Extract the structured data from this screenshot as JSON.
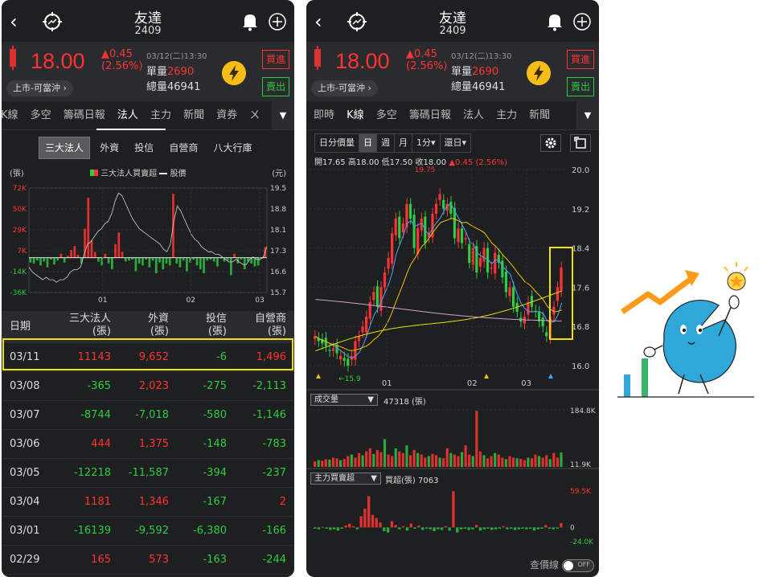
{
  "stock": {
    "name": "友達",
    "code": "2409",
    "price": "18.00",
    "change": "▲0.45",
    "change_pct": "(2.56%)",
    "datetime": "03/12(二)13:30",
    "unit_vol_label": "單量",
    "unit_vol": "2690",
    "total_vol_label": "總量",
    "total_vol": "46941",
    "market": "上市-可當沖",
    "buy": "買進",
    "sell": "賣出"
  },
  "left": {
    "tabs": [
      "K線",
      "多空",
      "籌碼日報",
      "法人",
      "主力",
      "新聞",
      "資券",
      "ㄨ"
    ],
    "active_tab": "法人",
    "subtabs": [
      "三大法人",
      "外資",
      "投信",
      "自營商",
      "八大行庫"
    ],
    "chart_labels": {
      "left_unit": "(張)",
      "right_unit": "(元)",
      "legend_bar": "三大法人買賣超",
      "legend_line": "股價"
    },
    "table_headers": {
      "date": "日期",
      "three": "三大法人",
      "three_unit": "(張)",
      "foreign": "外資",
      "foreign_unit": "(張)",
      "trust": "投信",
      "trust_unit": "(張)",
      "dealer": "自營商",
      "dealer_unit": "(張)"
    },
    "rows": [
      {
        "date": "03/11",
        "three": "11143",
        "foreign": "9,652",
        "trust": "-6",
        "dealer": "1,496"
      },
      {
        "date": "03/08",
        "three": "-365",
        "foreign": "2,023",
        "trust": "-275",
        "dealer": "-2,113"
      },
      {
        "date": "03/07",
        "three": "-8744",
        "foreign": "-7,018",
        "trust": "-580",
        "dealer": "-1,146"
      },
      {
        "date": "03/06",
        "three": "444",
        "foreign": "1,375",
        "trust": "-148",
        "dealer": "-783"
      },
      {
        "date": "03/05",
        "three": "-12218",
        "foreign": "-11,587",
        "trust": "-394",
        "dealer": "-237"
      },
      {
        "date": "03/04",
        "three": "1181",
        "foreign": "1,346",
        "trust": "-167",
        "dealer": "2"
      },
      {
        "date": "03/01",
        "three": "-16139",
        "foreign": "-9,592",
        "trust": "-6,380",
        "dealer": "-166"
      },
      {
        "date": "02/29",
        "three": "165",
        "foreign": "573",
        "trust": "-163",
        "dealer": "-244"
      }
    ]
  },
  "right": {
    "tabs": [
      "即時",
      "K線",
      "多空",
      "籌碼日報",
      "法人",
      "主力",
      "新聞"
    ],
    "active_tab": "K線",
    "toolbar": [
      "日分價量",
      "日",
      "週",
      "月",
      "1分▾",
      "還日▾"
    ],
    "active_tool": "日",
    "ohlc": {
      "o": "開17.65",
      "h": "高18.00",
      "l": "低17.50",
      "c": "收18.00",
      "chg": "▲0.45 (2.56%)"
    },
    "vol_select": "成交量",
    "vol_value": "47318 (張)",
    "main_select": "主力買賣超",
    "main_value": "買超(張) 7063",
    "check_line": "查價線",
    "toggle": "OFF"
  },
  "chart_data": [
    {
      "type": "bar",
      "title": "三大法人買賣超",
      "ylabel": "(張)",
      "ylabel_right": "(元)",
      "y_ticks": [
        "72K",
        "50K",
        "29K",
        "7K",
        "-14K",
        "-36K"
      ],
      "y_right_ticks": [
        "19.5",
        "18.8",
        "18.1",
        "17.3",
        "16.6",
        "15.7"
      ],
      "x_ticks": [
        "01",
        "02",
        "03"
      ],
      "series": [
        {
          "name": "三大法人買賣超",
          "values": [
            -5,
            -6,
            -3,
            -8,
            -4,
            -10,
            -2,
            -7,
            -3,
            4,
            -5,
            2,
            8,
            12,
            3,
            -6,
            30,
            62,
            18,
            6,
            -4,
            -8,
            4,
            -6,
            -12,
            14,
            26,
            6,
            -4,
            -3,
            -2,
            -14,
            -6,
            -8,
            -2,
            -10,
            -3,
            -16,
            -5,
            -12,
            -6,
            -8,
            66,
            -6,
            -10,
            -3,
            -14,
            -5,
            -2,
            -8,
            -12,
            -16,
            -3,
            -2,
            -4,
            -9,
            -1,
            -4,
            -3,
            -18,
            4,
            -6,
            -2,
            -12,
            -4,
            -6,
            -9,
            -8,
            -1,
            11
          ]
        },
        {
          "name": "股價",
          "values": [
            16.7,
            16.5,
            16.4,
            16.3,
            16.2,
            16.3,
            16.2,
            16.2,
            16.1,
            16.2,
            16.2,
            16.3,
            16.5,
            16.6,
            16.6,
            16.7,
            17.2,
            17.6,
            17.7,
            17.9,
            18.1,
            18.2,
            18.4,
            18.5,
            18.8,
            19.3,
            19.6,
            19.5,
            19.2,
            18.9,
            18.6,
            18.4,
            18.2,
            18.1,
            18.0,
            17.9,
            17.8,
            17.7,
            17.6,
            17.4,
            17.3,
            17.6,
            18.5,
            19.1,
            18.9,
            18.6,
            18.3,
            18.0,
            17.8,
            17.7,
            17.5,
            17.4,
            17.3,
            17.3,
            17.2,
            17.2,
            17.1,
            17.0,
            16.9,
            16.9,
            17.0,
            16.9,
            16.8,
            16.8,
            17.0,
            17.1,
            17.0,
            17.0,
            17.1,
            17.5
          ]
        }
      ]
    },
    {
      "type": "line",
      "title": "K線",
      "y_ticks": [
        "20.0",
        "19.2",
        "18.4",
        "17.6",
        "16.8",
        "16.0"
      ],
      "ylim": [
        16.0,
        20.0
      ],
      "x_ticks": [
        "01",
        "02",
        "03"
      ],
      "annotations": [
        "19.75",
        "15.9"
      ],
      "close": [
        16.6,
        16.5,
        16.45,
        16.4,
        16.3,
        16.35,
        16.25,
        16.2,
        16.1,
        16.0,
        16.2,
        16.5,
        16.6,
        16.8,
        17.0,
        17.3,
        17.5,
        17.2,
        17.6,
        17.9,
        18.2,
        18.7,
        19.0,
        18.6,
        18.9,
        19.3,
        19.0,
        18.4,
        18.8,
        19.0,
        18.5,
        18.7,
        19.1,
        19.3,
        19.5,
        19.2,
        19.3,
        19.1,
        18.6,
        18.8,
        18.5,
        18.6,
        18.1,
        18.4,
        17.9,
        18.2,
        18.4,
        17.9,
        18.0,
        18.3,
        18.1,
        17.8,
        17.5,
        17.6,
        17.2,
        17.1,
        16.9,
        17.0,
        17.3,
        17.2,
        17.1,
        16.9,
        16.8,
        16.6,
        17.0,
        17.2,
        17.6,
        18.0
      ]
    },
    {
      "type": "bar",
      "title": "成交量",
      "y_ticks": [
        "184.8K",
        "11.9K"
      ],
      "values": [
        18,
        22,
        20,
        25,
        24,
        30,
        28,
        22,
        26,
        35,
        40,
        30,
        45,
        38,
        50,
        60,
        42,
        55,
        48,
        90,
        40,
        35,
        60,
        50,
        45,
        70,
        38,
        55,
        45,
        40,
        30,
        35,
        42,
        38,
        30,
        28,
        60,
        45,
        40,
        35,
        48,
        70,
        40,
        35,
        182,
        50,
        38,
        28,
        35,
        45,
        40,
        30,
        25,
        35,
        30,
        28,
        26,
        22,
        30,
        28,
        40,
        35,
        30,
        38,
        25,
        45,
        30,
        47
      ]
    },
    {
      "type": "bar",
      "title": "主力買賣超",
      "y_ticks": [
        "59.5K",
        "0",
        "-24.0K"
      ],
      "values": [
        -2,
        -3,
        1,
        -2,
        -4,
        -3,
        -5,
        -2,
        3,
        6,
        2,
        -3,
        18,
        30,
        50,
        20,
        15,
        8,
        -6,
        -8,
        10,
        4,
        -3,
        2,
        -5,
        6,
        -2,
        3,
        -4,
        -2,
        -3,
        -6,
        -3,
        -4,
        2,
        -5,
        58,
        -8,
        -3,
        -2,
        -4,
        -3,
        4,
        -5,
        -3,
        -2,
        -4,
        -3,
        -2,
        2,
        -3,
        -2,
        -4,
        -3,
        -2,
        -3,
        -2,
        -5,
        -3,
        -2,
        4,
        -2,
        -3,
        -2,
        7
      ]
    }
  ]
}
